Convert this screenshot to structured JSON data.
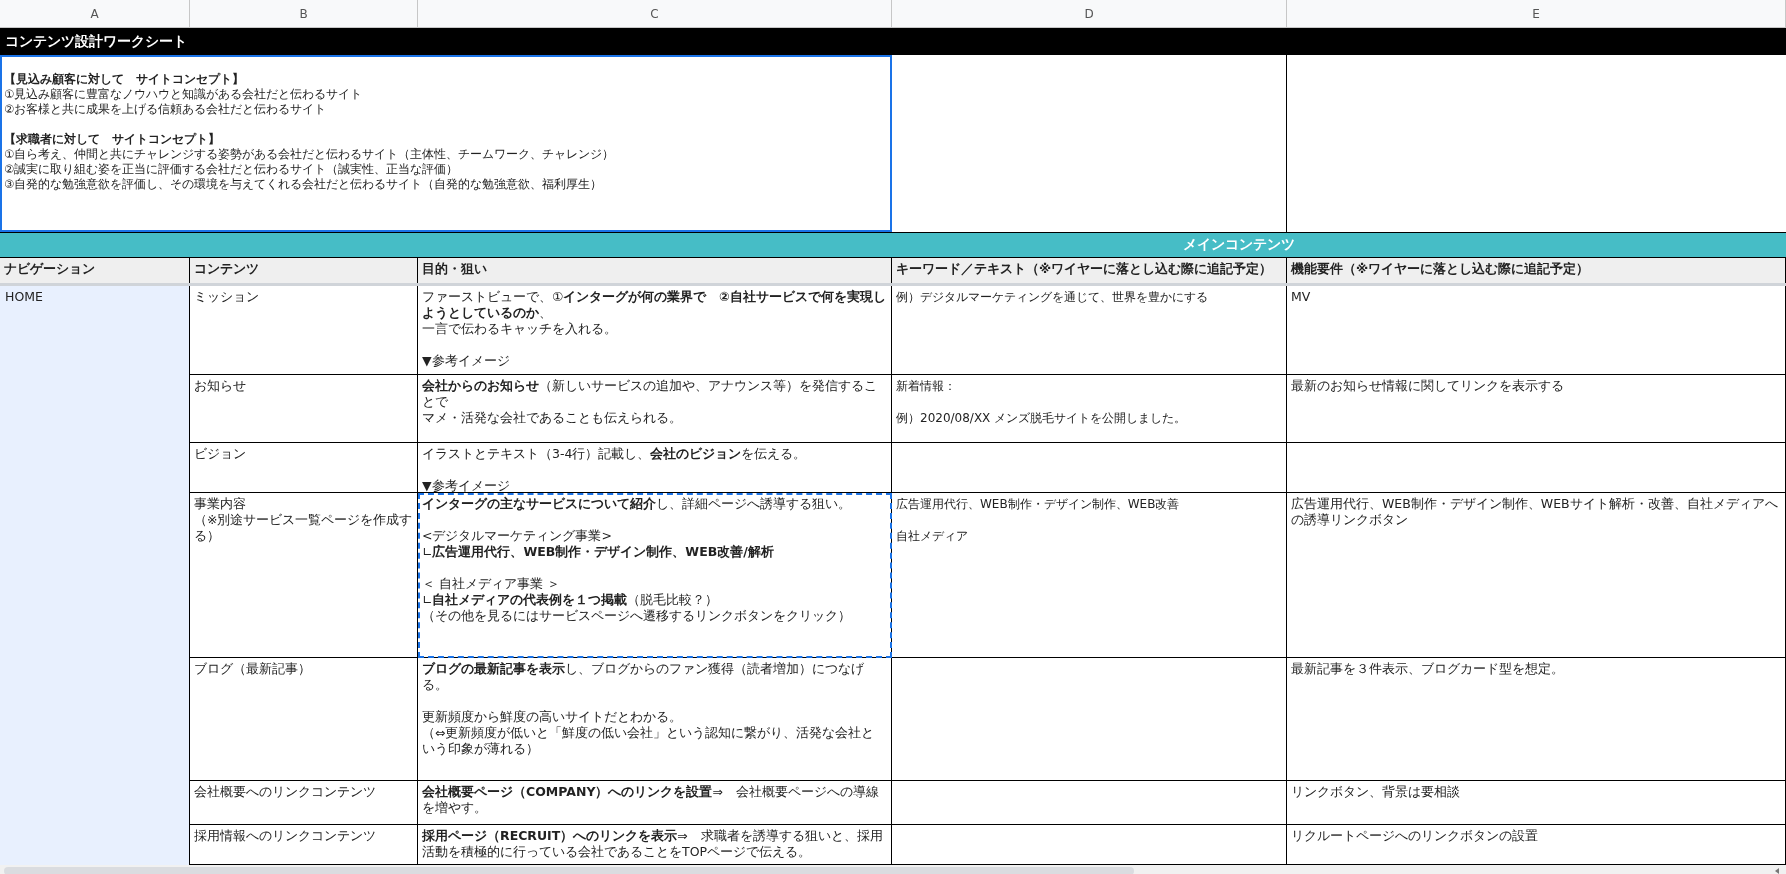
{
  "column_headers": [
    "A",
    "B",
    "C",
    "D",
    "E"
  ],
  "title": "コンテンツ設計ワークシート",
  "concept": {
    "selected": true,
    "sections": [
      {
        "heading": "【見込み顧客に対して　サイトコンセプト】",
        "items": [
          "①見込み顧客に豊富なノウハウと知識がある会社だと伝わるサイト",
          "②お客様と共に成果を上げる信頼ある会社だと伝わるサイト"
        ]
      },
      {
        "heading": "【求職者に対して　サイトコンセプト】",
        "items": [
          "①自ら考え、仲間と共にチャレンジする姿勢がある会社だと伝わるサイト（主体性、チームワーク、チャレンジ）",
          "②誠実に取り組む姿を正当に評価する会社だと伝わるサイト（誠実性、正当な評価）",
          "③自発的な勉強意欲を評価し、その環境を与えてくれる会社だと伝わるサイト（自発的な勉強意欲、福利厚生）"
        ]
      }
    ]
  },
  "section_header": "メインコンテンツ",
  "table": {
    "columns": [
      "ナビゲーション",
      "コンテンツ",
      "目的・狙い",
      "キーワード／テキスト（※ワイヤーに落とし込む際に追記予定）",
      "機能要件（※ワイヤーに落とし込む際に追記予定）"
    ],
    "navigation": "HOME",
    "rows": [
      {
        "content": [
          [
            "ミッション"
          ]
        ],
        "purpose": [
          [
            "ファーストビューで、①**インターグが何の業界で　②自社サービスで何を実現しようとしているのか**、",
            "一言で伝わるキャッチを入れる。"
          ],
          [
            "▼参考イメージ"
          ]
        ],
        "keywords": [
          [
            "例）デジタルマーケティングを通じて、世界を豊かにする"
          ]
        ],
        "features": [
          [
            "MV"
          ]
        ],
        "copy_border": false
      },
      {
        "content": [
          [
            "お知らせ"
          ]
        ],
        "purpose": [
          [
            "**会社からのお知らせ**（新しいサービスの追加や、アナウンス等）を発信することで",
            "マメ・活発な会社であることも伝えられる。"
          ]
        ],
        "keywords": [
          [
            "新着情報："
          ],
          [
            "例）2020/08/XX メンズ脱毛サイトを公開しました。"
          ]
        ],
        "features": [
          [
            "最新のお知らせ情報に関してリンクを表示する"
          ]
        ],
        "copy_border": false
      },
      {
        "content": [
          [
            "ビジョン"
          ]
        ],
        "purpose": [
          [
            "イラストとテキスト（3-4行）記載し、**会社のビジョン**を伝える。"
          ],
          [
            "▼参考イメージ"
          ]
        ],
        "keywords": [],
        "features": [],
        "copy_border": false
      },
      {
        "content": [
          [
            "事業内容",
            "（※別途サービス一覧ページを作成する）"
          ]
        ],
        "purpose": [
          [
            "**インターグの主なサービスについて紹介**し、詳細ページへ誘導する狙い。"
          ],
          [
            "<デジタルマーケティング事業>",
            "∟**広告運用代行、WEB制作・デザイン制作、WEB改善/解析**"
          ],
          [
            "＜ 自社メディア事業 ＞",
            "∟**自社メディアの代表例を１つ掲載**（脱毛比較？）",
            "（その他を見るにはサービスページへ遷移するリンクボタンをクリック）"
          ]
        ],
        "keywords": [
          [
            "広告運用代行、WEB制作・デザイン制作、WEB改善"
          ],
          [
            "自社メディア"
          ]
        ],
        "features": [
          [
            "広告運用代行、WEB制作・デザイン制作、WEBサイト解析・改善、自社メディアへの誘導リンクボタン"
          ]
        ],
        "copy_border": true
      },
      {
        "content": [
          [
            "ブログ（最新記事）"
          ]
        ],
        "purpose": [
          [
            "**ブログの最新記事を表示**し、ブログからのファン獲得（読者増加）につなげる。"
          ],
          [
            "更新頻度から鮮度の高いサイトだとわかる。",
            "（⇔更新頻度が低いと「鮮度の低い会社」という認知に繋がり、活発な会社という印象が薄れる）"
          ]
        ],
        "keywords": [],
        "features": [
          [
            "最新記事を３件表示、ブログカード型を想定。"
          ]
        ],
        "copy_border": false
      },
      {
        "content": [
          [
            "会社概要へのリンクコンテンツ"
          ]
        ],
        "purpose": [
          [
            "**会社概要ページ（COMPANY）へのリンクを設置**⇒　会社概要ページへの導線を増やす。"
          ]
        ],
        "keywords": [],
        "features": [
          [
            "リンクボタン、背景は要相談"
          ]
        ],
        "copy_border": false
      },
      {
        "content": [
          [
            "採用情報へのリンクコンテンツ"
          ]
        ],
        "purpose": [
          [
            "**採用ページ（RECRUIT）へのリンクを表示**⇒　求職者を誘導する狙いと、採用活動を積極的に行っている会社であることをTOPページで伝える。"
          ]
        ],
        "keywords": [],
        "features": [
          [
            "リクルートページへのリンクボタンの設置"
          ]
        ],
        "copy_border": false
      }
    ]
  }
}
